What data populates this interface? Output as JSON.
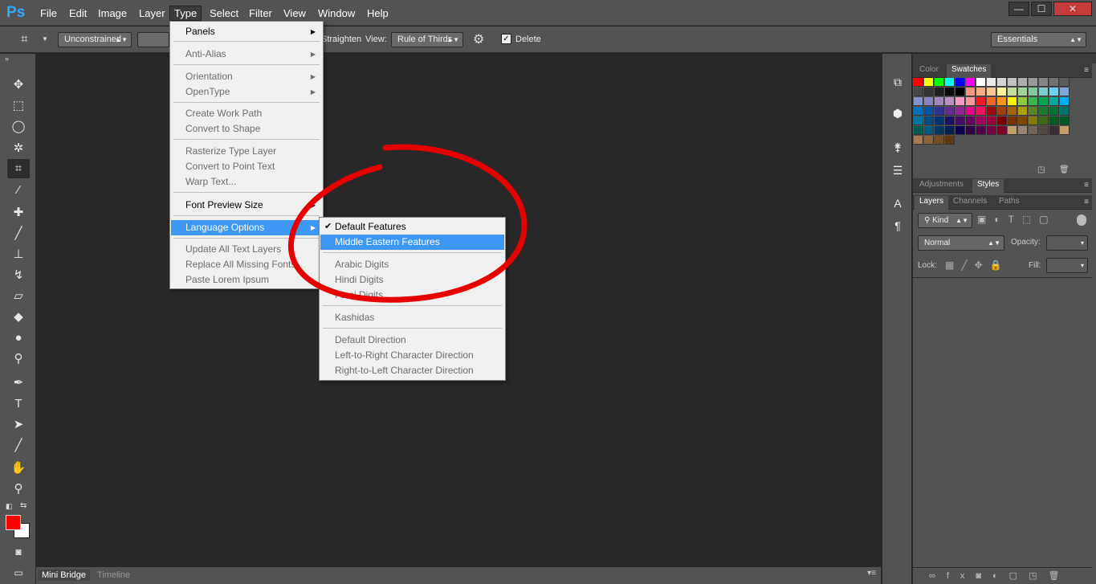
{
  "app": {
    "logo": "Ps"
  },
  "menubar": {
    "items": [
      "File",
      "Edit",
      "Image",
      "Layer",
      "Type",
      "Select",
      "Filter",
      "View",
      "Window",
      "Help"
    ]
  },
  "window_controls": {
    "minimize": "—",
    "maximize": "☐",
    "close": "✕"
  },
  "options": {
    "ratio": "Unconstrained",
    "straighten": "Straighten",
    "view_label": "View:",
    "view_value": "Rule of Thirds",
    "delete_label": "Delete",
    "workspace": "Essentials"
  },
  "type_menu": {
    "items": [
      {
        "label": "Panels",
        "enabled": true,
        "submenu": true
      },
      {
        "label": "Anti-Alias",
        "enabled": false,
        "submenu": true
      },
      {
        "label": "Orientation",
        "enabled": false,
        "submenu": true
      },
      {
        "label": "OpenType",
        "enabled": false,
        "submenu": true
      },
      {
        "label": "Create Work Path",
        "enabled": false
      },
      {
        "label": "Convert to Shape",
        "enabled": false
      },
      {
        "label": "Rasterize Type Layer",
        "enabled": false
      },
      {
        "label": "Convert to Point Text",
        "enabled": false
      },
      {
        "label": "Warp Text...",
        "enabled": false
      },
      {
        "label": "Font Preview Size",
        "enabled": true,
        "submenu": true
      },
      {
        "label": "Language Options",
        "enabled": true,
        "submenu": true,
        "highlighted": true
      },
      {
        "label": "Update All Text Layers",
        "enabled": false
      },
      {
        "label": "Replace All Missing Fonts",
        "enabled": false
      },
      {
        "label": "Paste Lorem Ipsum",
        "enabled": false
      }
    ]
  },
  "language_menu": {
    "items": [
      {
        "label": "Default Features",
        "checked": true
      },
      {
        "label": "Middle Eastern Features",
        "highlighted": true
      },
      {
        "label": "Arabic Digits",
        "enabled": false
      },
      {
        "label": "Hindi Digits",
        "enabled": false
      },
      {
        "label": "Farsi Digits",
        "enabled": false
      },
      {
        "label": "Kashidas",
        "enabled": false
      },
      {
        "label": "Default Direction",
        "enabled": false
      },
      {
        "label": "Left-to-Right Character Direction",
        "enabled": false
      },
      {
        "label": "Right-to-Left Character Direction",
        "enabled": false
      }
    ]
  },
  "bottom_tabs": [
    "Mini Bridge",
    "Timeline"
  ],
  "panels": {
    "color_tabs": [
      "Color",
      "Swatches"
    ],
    "adj_tabs": [
      "Adjustments",
      "Styles"
    ],
    "layer_tabs": [
      "Layers",
      "Channels",
      "Paths"
    ],
    "kind": "Kind",
    "blend": "Normal",
    "opacity_label": "Opacity:",
    "lock_label": "Lock:",
    "fill_label": "Fill:"
  },
  "swatches": [
    "#ff0000",
    "#ffff00",
    "#00ff00",
    "#00ffff",
    "#0000ff",
    "#ff00ff",
    "#ffffff",
    "#ebebeb",
    "#d6d6d6",
    "#c2c2c2",
    "#adadad",
    "#999999",
    "#858585",
    "#707070",
    "#5c5c5c",
    "#474747",
    "#333333",
    "#1f1f1f",
    "#0a0a0a",
    "#000000",
    "#f7977a",
    "#f9ad81",
    "#fdc68a",
    "#fff79a",
    "#c4df9b",
    "#a3d39c",
    "#82ca9d",
    "#7bcdc8",
    "#6ecff6",
    "#7ea7d8",
    "#8493ca",
    "#8882be",
    "#a187be",
    "#bc8dbf",
    "#f49ac2",
    "#f6989d",
    "#ed1c24",
    "#f26522",
    "#f7941d",
    "#fff200",
    "#8dc73f",
    "#39b54a",
    "#00a651",
    "#00a99d",
    "#00aeef",
    "#0072bc",
    "#0054a6",
    "#2e3192",
    "#662d91",
    "#92278f",
    "#ec008c",
    "#ed145b",
    "#9e0b0f",
    "#a0410d",
    "#a36209",
    "#aba000",
    "#598527",
    "#1a7b30",
    "#007236",
    "#00746b",
    "#0076a3",
    "#004b80",
    "#003471",
    "#1b1464",
    "#440e62",
    "#630460",
    "#9e005d",
    "#9e0039",
    "#790000",
    "#7b2e00",
    "#7d4900",
    "#827b00",
    "#406618",
    "#005e20",
    "#005826",
    "#005952",
    "#005b7f",
    "#003663",
    "#002157",
    "#0d004c",
    "#32004b",
    "#4b0049",
    "#7b0046",
    "#7a0026",
    "#c69c6d",
    "#998675",
    "#736357",
    "#534741",
    "#362f2d",
    "#c69c6d",
    "#a67c52",
    "#8c6239",
    "#754c24",
    "#603913"
  ]
}
